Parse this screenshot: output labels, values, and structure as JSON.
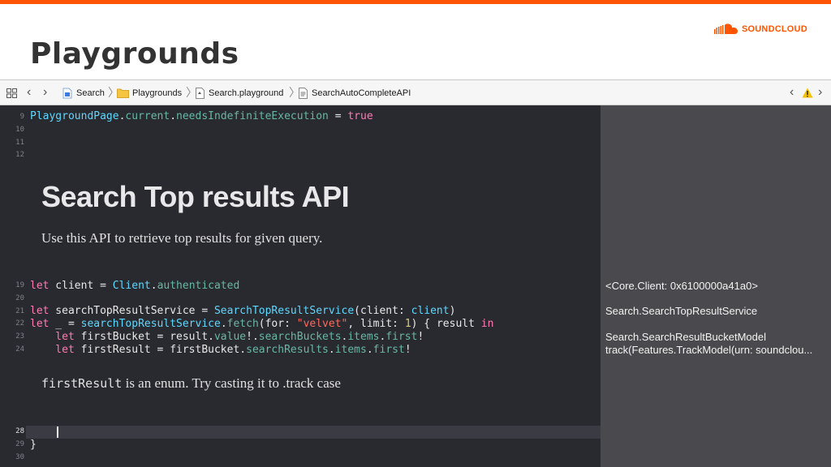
{
  "slide": {
    "title": "Playgrounds",
    "brand": "SOUNDCLOUD",
    "accent_color": "#ff5500"
  },
  "jumpbar": {
    "grid_icon": "grid-icon",
    "crumbs": [
      {
        "icon": "swift-file-icon",
        "label": "Search"
      },
      {
        "icon": "folder-icon",
        "label": "Playgrounds"
      },
      {
        "icon": "playground-file-icon",
        "label": "Search.playground"
      },
      {
        "icon": "page-icon",
        "label": "SearchAutoCompleteAPI"
      }
    ],
    "warning_icon": "warning-icon"
  },
  "gutter": {
    "line_numbers": [
      "9",
      "10",
      "11",
      "12",
      "19",
      "20",
      "21",
      "22",
      "23",
      "24",
      "28",
      "29",
      "30"
    ]
  },
  "code": {
    "line9": {
      "a": "PlaygroundPage",
      "b": ".",
      "c": "current",
      "d": ".",
      "e": "needsIndefiniteExecution",
      "f": " = ",
      "g": "true"
    },
    "line19": {
      "a": "let",
      "b": " client = ",
      "c": "Client",
      "d": ".",
      "e": "authenticated"
    },
    "line21": {
      "a": "let",
      "b": " searchTopResultService = ",
      "c": "SearchTopResultService",
      "d": "(client: ",
      "e": "client",
      "f": ")"
    },
    "line22": {
      "a": "let",
      "b": " _ = ",
      "c": "searchTopResultService",
      "d": ".",
      "e": "fetch",
      "f": "(for: ",
      "g": "\"velvet\"",
      "h": ", limit: ",
      "i": "1",
      "j": ") { result ",
      "k": "in"
    },
    "line23": {
      "a": "    let",
      "b": " firstBucket = result.",
      "c": "value",
      "d": "!.",
      "e": "searchBuckets",
      "f": ".",
      "g": "items",
      "h": ".",
      "i": "first",
      "j": "!"
    },
    "line24": {
      "a": "    let",
      "b": " firstResult = firstBucket.",
      "c": "searchResults",
      "d": ".",
      "e": "items",
      "f": ".",
      "g": "first",
      "h": "!"
    },
    "line29": "}"
  },
  "markup": {
    "heading": "Search Top results API",
    "paragraph": "Use this API to retrieve top results for given query.",
    "note_code": "firstResult",
    "note_text": " is an enum. Try casting it to .track case"
  },
  "results": {
    "r19": "<Core.Client: 0x6100000a41a0>",
    "r21": "Search.SearchTopResultService",
    "r23": "Search.SearchResultBucketModel",
    "r24": "track(Features.TrackModel(urn: soundclou..."
  }
}
